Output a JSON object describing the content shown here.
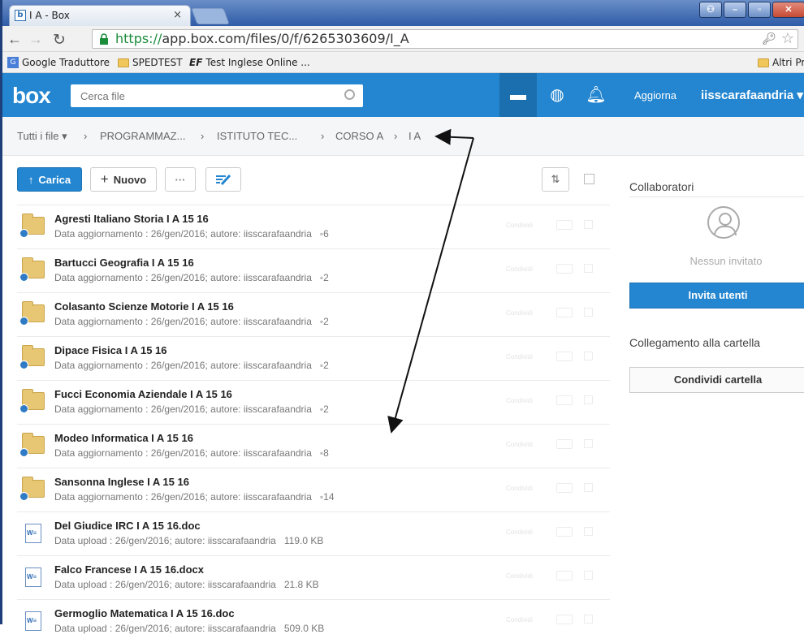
{
  "browser": {
    "tab_title": "I A - Box",
    "tab_close": "×",
    "url_prefix": "https://",
    "url_rest": "app.box.com/files/0/f/6265303609/I_A",
    "bookmarks": [
      "Google Traduttore",
      "SPEDTEST",
      "EF",
      "Test Inglese Online ...",
      "Altri Pr"
    ]
  },
  "header": {
    "logo": "box",
    "search_placeholder": "Cerca file",
    "update": "Aggiorna",
    "user": "iisscarafaandria ▾"
  },
  "breadcrumb": [
    "Tutti i file ▾",
    "›",
    "PROGRAMMAZ...",
    "›",
    "ISTITUTO TEC...",
    "›",
    "CORSO A",
    "›",
    "I A"
  ],
  "toolbar": {
    "upload": "Carica",
    "new": "Nuovo",
    "more": "···",
    "upload_icon": "↑",
    "new_icon": "+"
  },
  "items": [
    {
      "type": "folder",
      "name": "Agresti Italiano Storia I A 15 16",
      "meta": "Data aggiornamento : 26/gen/2016; autore: iisscarafaandria",
      "count": "6"
    },
    {
      "type": "folder",
      "name": "Bartucci Geografia I A 15 16",
      "meta": "Data aggiornamento : 26/gen/2016; autore: iisscarafaandria",
      "count": "2"
    },
    {
      "type": "folder",
      "name": "Colasanto Scienze Motorie I A 15 16",
      "meta": "Data aggiornamento : 26/gen/2016; autore: iisscarafaandria",
      "count": "2"
    },
    {
      "type": "folder",
      "name": "Dipace Fisica I A 15 16",
      "meta": "Data aggiornamento : 26/gen/2016; autore: iisscarafaandria",
      "count": "2"
    },
    {
      "type": "folder",
      "name": "Fucci Economia Aziendale I A 15 16",
      "meta": "Data aggiornamento : 26/gen/2016; autore: iisscarafaandria",
      "count": "2"
    },
    {
      "type": "folder",
      "name": "Modeo Informatica I A 15 16",
      "meta": "Data aggiornamento : 26/gen/2016; autore: iisscarafaandria",
      "count": "8"
    },
    {
      "type": "folder",
      "name": "Sansonna Inglese I A 15 16",
      "meta": "Data aggiornamento : 26/gen/2016; autore: iisscarafaandria",
      "count": "14"
    },
    {
      "type": "doc",
      "name": "Del Giudice IRC I A 15 16.doc",
      "meta": "Data upload : 26/gen/2016; autore: iisscarafaandria",
      "count": "119.0 KB"
    },
    {
      "type": "doc",
      "name": "Falco Francese I A 15 16.docx",
      "meta": "Data upload : 26/gen/2016; autore: iisscarafaandria",
      "count": "21.8 KB"
    },
    {
      "type": "doc",
      "name": "Germoglio Matematica I A 15 16.doc",
      "meta": "Data upload : 26/gen/2016; autore: iisscarafaandria",
      "count": "509.0 KB"
    }
  ],
  "row_share": "Condividi",
  "sidebar": {
    "collaborators": "Collaboratori",
    "no_invited": "Nessun invitato",
    "invite": "Invita utenti",
    "link_title": "Collegamento alla cartella",
    "share_folder": "Condividi cartella"
  }
}
